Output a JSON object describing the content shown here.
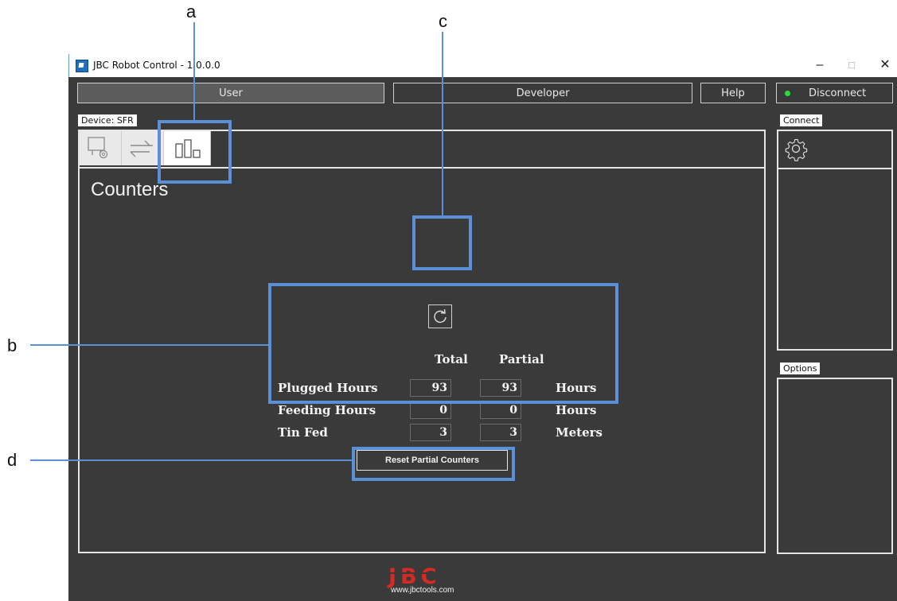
{
  "callouts": {
    "a": "a",
    "b": "b",
    "c": "c",
    "d": "d"
  },
  "window": {
    "title": "JBC Robot Control - 1.0.0.0",
    "controls": {
      "minimize": "–",
      "maximize": "□",
      "close": "✕"
    }
  },
  "toolbar": {
    "user": "User",
    "developer": "Developer",
    "help": "Help",
    "disconnect": "Disconnect"
  },
  "device": {
    "tab_label": "Device: SFR",
    "page_title": "Counters",
    "icons": [
      "station-settings-icon",
      "transfer-arrows-icon",
      "counters-bar-icon"
    ]
  },
  "counters": {
    "headers": {
      "total": "Total",
      "partial": "Partial"
    },
    "rows": [
      {
        "label": "Plugged Hours",
        "total": "93",
        "partial": "93",
        "unit": "Hours"
      },
      {
        "label": "Feeding Hours",
        "total": "0",
        "partial": "0",
        "unit": "Hours"
      },
      {
        "label": "Tin Fed",
        "total": "3",
        "partial": "3",
        "unit": "Meters"
      }
    ],
    "reset_label": "Reset Partial Counters"
  },
  "connect": {
    "tab_label": "Connect"
  },
  "options": {
    "tab_label": "Options"
  },
  "footer": {
    "logo": "JBC",
    "website": "www.jbctools.com"
  },
  "colors": {
    "background": "#3a3a3a",
    "callout": "#5b8fd6",
    "logo_red": "#d62b24",
    "status_green": "#27e036"
  }
}
